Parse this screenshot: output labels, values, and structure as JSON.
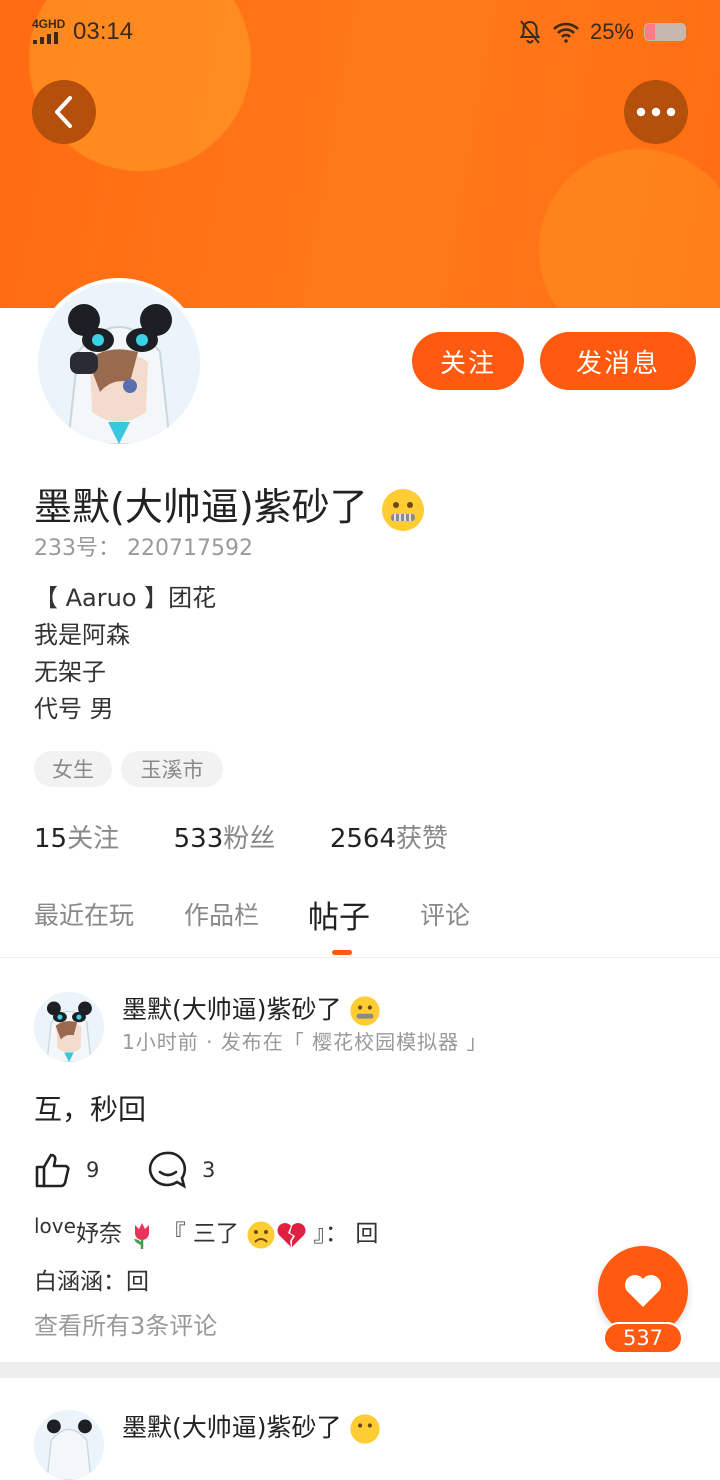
{
  "status_bar": {
    "network": "4GHD",
    "time": "03:14",
    "battery_percent": "25%",
    "battery_level": 0.25
  },
  "header": {
    "back_icon": "chevron-left-icon",
    "more_icon": "more-dots-icon"
  },
  "profile": {
    "follow_label": "关注",
    "message_label": "发消息",
    "nickname": "墨默(大帅逼)紫砂了",
    "nickname_emoji": "zipper-mouth-face",
    "uid_label": "233号：",
    "uid_value": "220717592",
    "bio_lines": [
      "【 Aaruo 】团花",
      "我是阿森",
      "无架子",
      "代号 男"
    ],
    "tags": [
      "女生",
      "玉溪市"
    ],
    "stats": {
      "following_count": "15",
      "following_label": "关注",
      "fans_count": "533",
      "fans_label": "粉丝",
      "likes_count": "2564",
      "likes_label": "获赞"
    }
  },
  "tabs": [
    {
      "label": "最近在玩",
      "active": false
    },
    {
      "label": "作品栏",
      "active": false
    },
    {
      "label": "帖子",
      "active": true
    },
    {
      "label": "评论",
      "active": false
    }
  ],
  "posts": [
    {
      "author": "墨默(大帅逼)紫砂了",
      "meta": "1小时前 · 发布在「 樱花校园模拟器 」",
      "text": "互，秒回",
      "like_count": "9",
      "comment_count": "3",
      "comments": [
        {
          "prefix": "love",
          "author": "妤奈",
          "suffix_open": "『 三了",
          "suffix_close": "』：",
          "text": "回"
        },
        {
          "author": "白涵涵：",
          "text": "回"
        }
      ],
      "see_all": "查看所有3条评论"
    },
    {
      "author": "墨默(大帅逼)紫砂了"
    }
  ],
  "fab": {
    "icon": "heart-icon",
    "count": "537"
  },
  "colors": {
    "accent": "#ff5a0f",
    "header_orange": "#ff7a1a"
  }
}
